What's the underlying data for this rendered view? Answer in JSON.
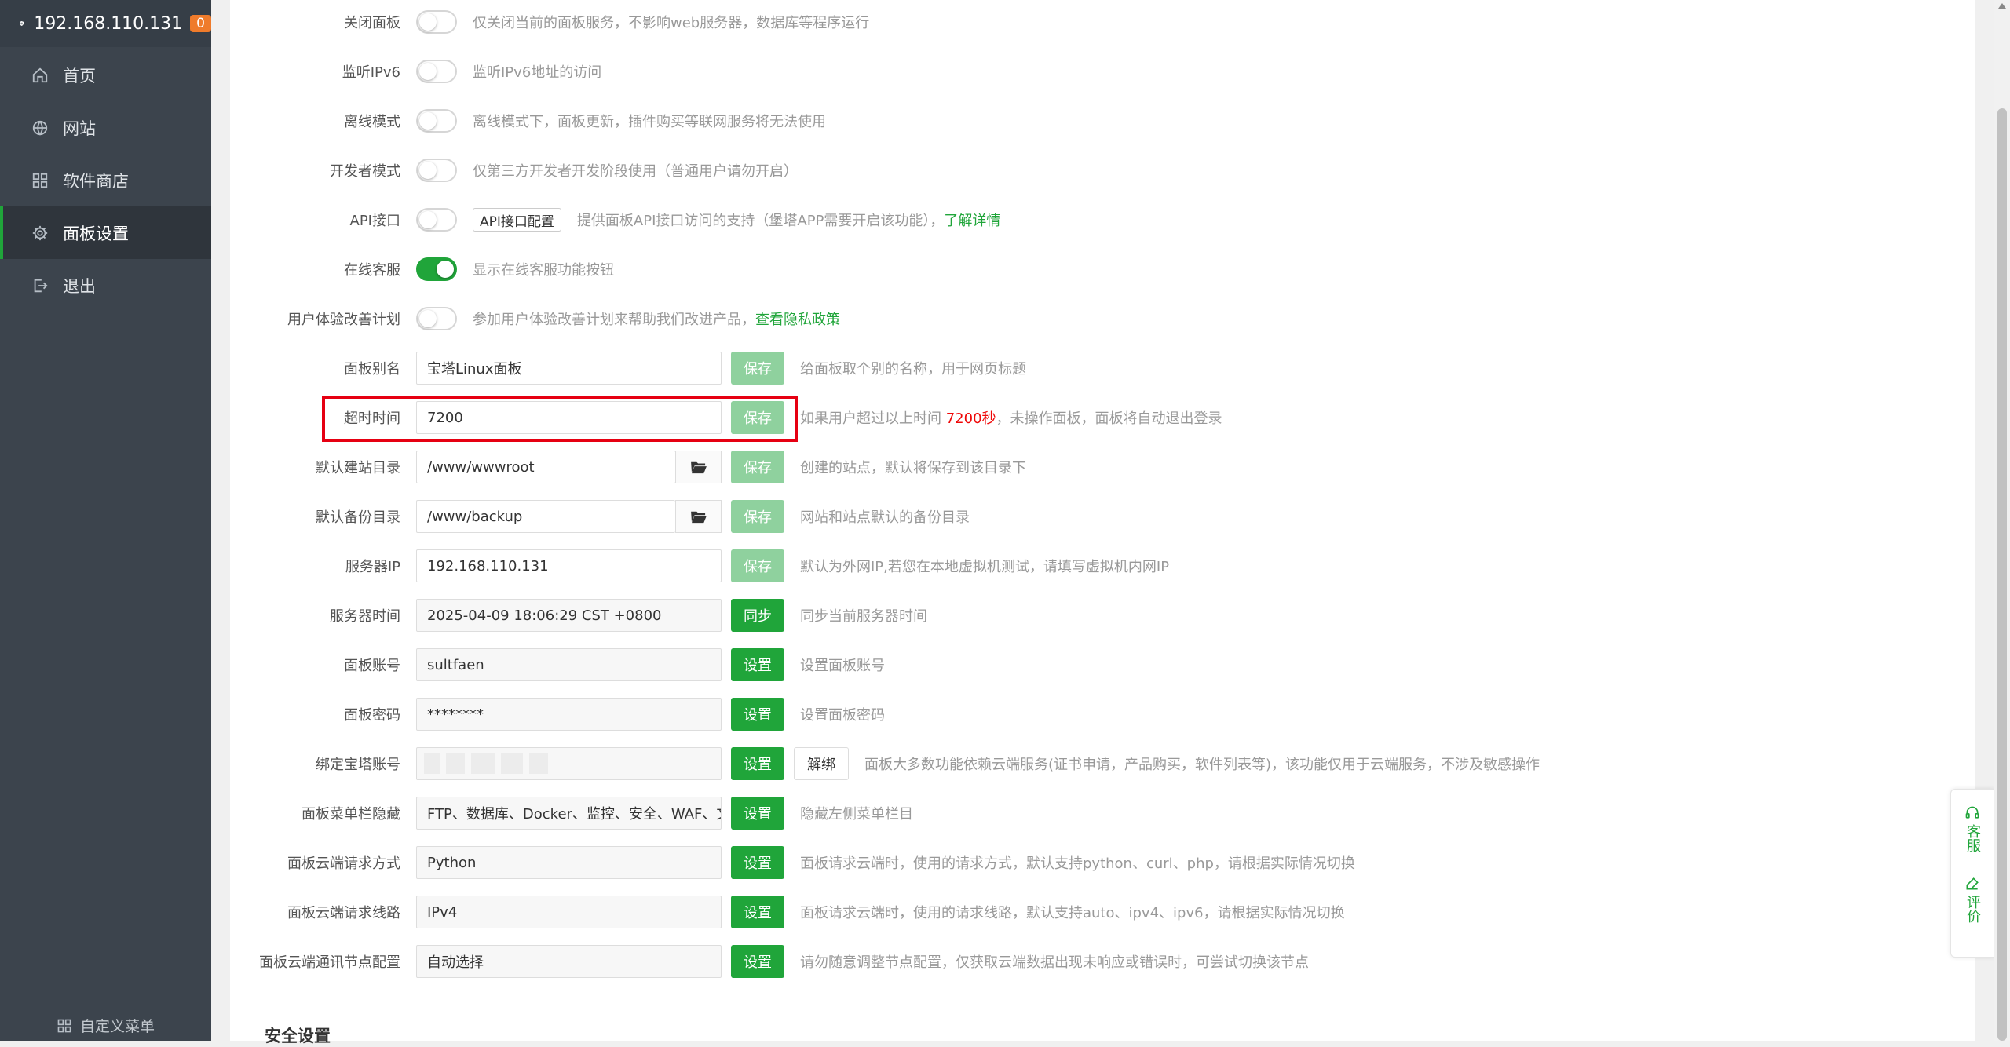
{
  "sidebar": {
    "host": "192.168.110.131",
    "badge": "0",
    "items": [
      {
        "label": "首页",
        "icon": "home-icon"
      },
      {
        "label": "网站",
        "icon": "globe-icon"
      },
      {
        "label": "软件商店",
        "icon": "grid-icon"
      },
      {
        "label": "面板设置",
        "icon": "gear-icon",
        "active": true
      },
      {
        "label": "退出",
        "icon": "logout-icon"
      }
    ],
    "footer": "自定义菜单"
  },
  "toggles": [
    {
      "label": "关闭面板",
      "on": false,
      "desc": "仅关闭当前的面板服务，不影响web服务器，数据库等程序运行"
    },
    {
      "label": "监听IPv6",
      "on": false,
      "desc": "监听IPv6地址的访问"
    },
    {
      "label": "离线模式",
      "on": false,
      "desc": "离线模式下，面板更新，插件购买等联网服务将无法使用"
    },
    {
      "label": "开发者模式",
      "on": false,
      "desc": "仅第三方开发者开发阶段使用（普通用户请勿开启）"
    },
    {
      "label": "API接口",
      "on": false,
      "button": "API接口配置",
      "desc": "提供面板API接口访问的支持（堡塔APP需要开启该功能），",
      "link": "了解详情"
    },
    {
      "label": "在线客服",
      "on": true,
      "desc": "显示在线客服功能按钮"
    },
    {
      "label": "用户体验改善计划",
      "on": false,
      "desc": "参加用户体验改善计划来帮助我们改进产品，",
      "link": "查看隐私政策"
    }
  ],
  "fields": {
    "alias": {
      "label": "面板别名",
      "value": "宝塔Linux面板",
      "button": "保存",
      "desc": "给面板取个别的名称，用于网页标题"
    },
    "timeout": {
      "label": "超时时间",
      "value": "7200",
      "button": "保存",
      "desc_pre": "如果用户超过以上时间 ",
      "desc_red": "7200秒",
      "desc_post": "，未操作面板，面板将自动退出登录"
    },
    "site_dir": {
      "label": "默认建站目录",
      "value": "/www/wwwroot",
      "button": "保存",
      "desc": "创建的站点，默认将保存到该目录下"
    },
    "backup_dir": {
      "label": "默认备份目录",
      "value": "/www/backup",
      "button": "保存",
      "desc": "网站和站点默认的备份目录"
    },
    "server_ip": {
      "label": "服务器IP",
      "value": "192.168.110.131",
      "button": "保存",
      "desc": "默认为外网IP,若您在本地虚拟机测试，请填写虚拟机内网IP"
    },
    "server_time": {
      "label": "服务器时间",
      "value": "2025-04-09 18:06:29 CST +0800",
      "button": "同步",
      "desc": "同步当前服务器时间"
    },
    "account": {
      "label": "面板账号",
      "value": "sultfaen",
      "button": "设置",
      "desc": "设置面板账号"
    },
    "password": {
      "label": "面板密码",
      "value": "********",
      "button": "设置",
      "desc": "设置面板密码"
    },
    "bind": {
      "label": "绑定宝塔账号",
      "button": "设置",
      "button2": "解绑",
      "desc": "面板大多数功能依赖云端服务(证书申请，产品购买，软件列表等)，该功能仅用于云端服务，不涉及敏感操作"
    },
    "menu_hide": {
      "label": "面板菜单栏隐藏",
      "value": "FTP、数据库、Docker、监控、安全、WAF、文",
      "button": "设置",
      "desc": "隐藏左侧菜单栏目"
    },
    "req_method": {
      "label": "面板云端请求方式",
      "value": "Python",
      "button": "设置",
      "desc": "面板请求云端时，使用的请求方式，默认支持python、curl、php，请根据实际情况切换"
    },
    "req_line": {
      "label": "面板云端请求线路",
      "value": "IPv4",
      "button": "设置",
      "desc": "面板请求云端时，使用的请求线路，默认支持auto、ipv4、ipv6，请根据实际情况切换"
    },
    "node": {
      "label": "面板云端通讯节点配置",
      "value": "自动选择",
      "button": "设置",
      "desc": "请勿随意调整节点配置，仅获取云端数据出现未响应或错误时，可尝试切换该节点"
    }
  },
  "section_title": "安全设置",
  "float": {
    "service": "客服",
    "review": "评价"
  },
  "colors": {
    "accent": "#20a53a",
    "sidebar": "#3c444d",
    "highlight": "#e60012",
    "warning": "#ef0808"
  }
}
